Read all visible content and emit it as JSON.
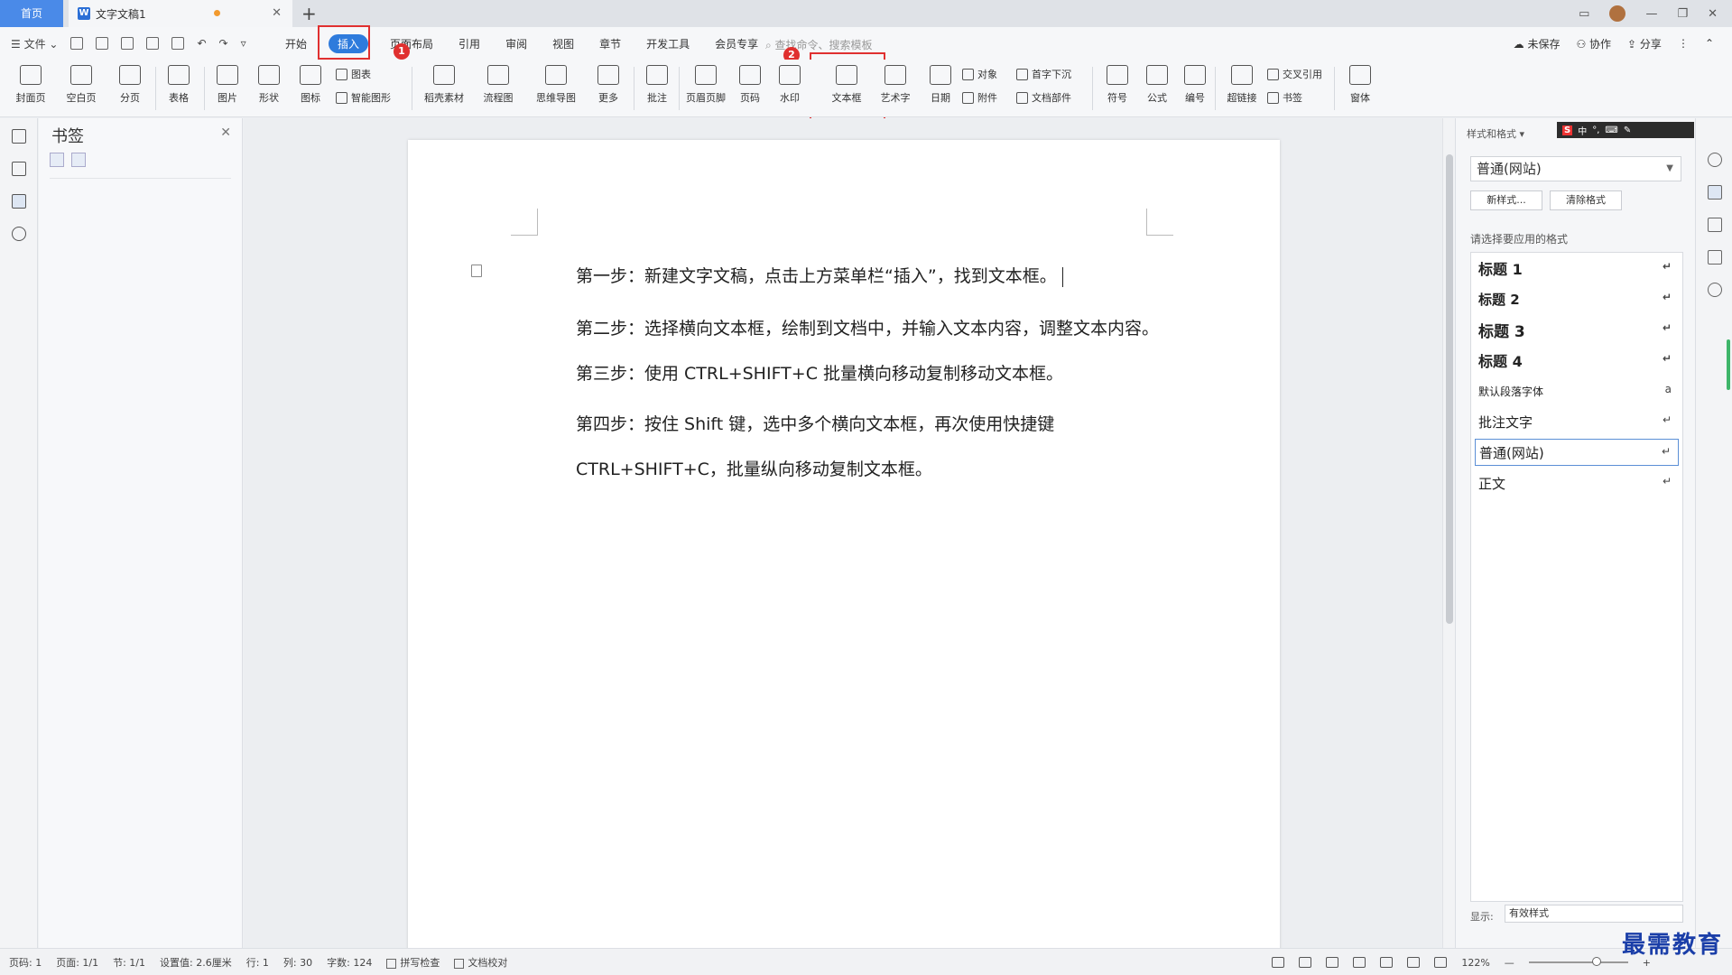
{
  "tabbar": {
    "home": "首页",
    "doc_icon": "W",
    "doc_title": "文字文稿1",
    "new_tab": "+"
  },
  "menubar": {
    "file": "文件",
    "tabs": [
      "开始",
      "插入",
      "页面布局",
      "引用",
      "审阅",
      "视图",
      "章节",
      "开发工具",
      "会员专享"
    ],
    "active_tab": "插入",
    "search_placeholder": "查找命令、搜索模板",
    "right": [
      "未保存",
      "协作",
      "分享"
    ]
  },
  "annotations": {
    "badge1": "1",
    "badge2": "2"
  },
  "ribbon": {
    "buttons": [
      "封面页",
      "空白页",
      "分页",
      "表格",
      "图片",
      "形状",
      "图标",
      "稻壳素材",
      "流程图",
      "思维导图",
      "更多",
      "批注",
      "页眉页脚",
      "页码",
      "水印",
      "文本框",
      "艺术字",
      "日期",
      "符号",
      "公式",
      "编号",
      "超链接",
      "窗体"
    ],
    "small": [
      "图表",
      "智能图形",
      "对象",
      "附件",
      "首字下沉",
      "文档部件",
      "交叉引用",
      "书签"
    ]
  },
  "bookmark_panel": {
    "title": "书签"
  },
  "document": {
    "paragraphs": [
      "第一步：新建文字文稿，点击上方菜单栏“插入”，找到文本框。",
      "第二步：选择横向文本框，绘制到文档中，并输入文本内容，调整文本内容。",
      "第三步：使用 CTRL+SHIFT+C 批量横向移动复制移动文本框。",
      "第四步：按住 Shift 键，选中多个横向文本框，再次使用快捷键",
      "CTRL+SHIFT+C，批量纵向移动复制文本框。"
    ]
  },
  "style_panel": {
    "header": "样式和格式",
    "ime": [
      "S",
      "中",
      "°,",
      "⌨",
      "✎"
    ],
    "current_style": "普通(网站)",
    "new_style": "新样式...",
    "clear_format": "清除格式",
    "prompt": "请选择要应用的格式",
    "styles": [
      {
        "name": "标题  1",
        "mark": "↵"
      },
      {
        "name": "标题  2",
        "mark": "↵"
      },
      {
        "name": "标题  3",
        "mark": "↵"
      },
      {
        "name": "标题  4",
        "mark": "↵"
      },
      {
        "name": "默认段落字体",
        "mark": "a"
      },
      {
        "name": "批注文字",
        "mark": "↵"
      },
      {
        "name": "普通(网站)",
        "mark": "↵"
      },
      {
        "name": "正文",
        "mark": "↵"
      }
    ],
    "show_label": "显示:",
    "show_value": "有效样式"
  },
  "statusbar": {
    "page_num": "页码: 1",
    "pages": "页面: 1/1",
    "section": "节: 1/1",
    "setting": "设置值: 2.6厘米",
    "row": "行: 1",
    "col": "列: 30",
    "words": "字数: 124",
    "spell": "拼写检查",
    "proof": "文档校对",
    "zoom": "122%"
  },
  "watermark": "最需教育",
  "colors": {
    "accent": "#2e7bdc",
    "annotation": "#e03030",
    "home_tab": "#4a8ae8"
  }
}
